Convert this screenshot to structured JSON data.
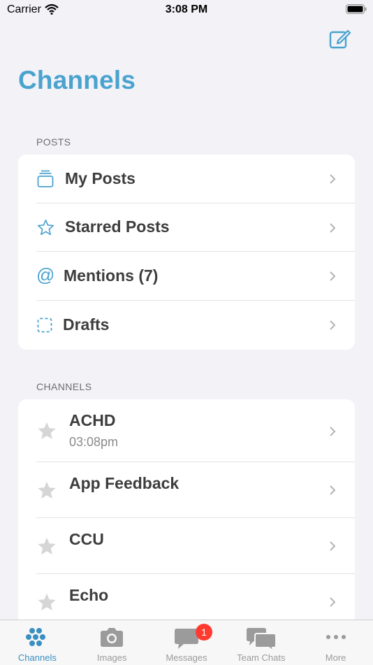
{
  "status_bar": {
    "carrier": "Carrier",
    "time": "3:08 PM"
  },
  "header": {
    "title": "Channels"
  },
  "posts_section": {
    "header": "POSTS",
    "items": [
      {
        "label": "My Posts",
        "icon": "stack-icon"
      },
      {
        "label": "Starred Posts",
        "icon": "star-outline-icon"
      },
      {
        "label": "Mentions (7)",
        "icon": "at-sign-icon"
      },
      {
        "label": "Drafts",
        "icon": "dashed-square-icon"
      }
    ]
  },
  "channels_section": {
    "header": "CHANNELS",
    "items": [
      {
        "name": "ACHD",
        "time": "03:08pm"
      },
      {
        "name": "App Feedback"
      },
      {
        "name": "CCU"
      },
      {
        "name": "Echo"
      }
    ]
  },
  "tab_bar": {
    "tabs": [
      {
        "label": "Channels",
        "icon": "dots-grid-icon",
        "active": true
      },
      {
        "label": "Images",
        "icon": "camera-icon"
      },
      {
        "label": "Messages",
        "icon": "chat-bubble-icon",
        "badge": "1"
      },
      {
        "label": "Team Chats",
        "icon": "double-chat-icon"
      },
      {
        "label": "More",
        "icon": "ellipsis-icon"
      }
    ]
  },
  "colors": {
    "accent": "#4aa3cf",
    "badge": "#ff3b30",
    "background": "#f2f2f7"
  }
}
